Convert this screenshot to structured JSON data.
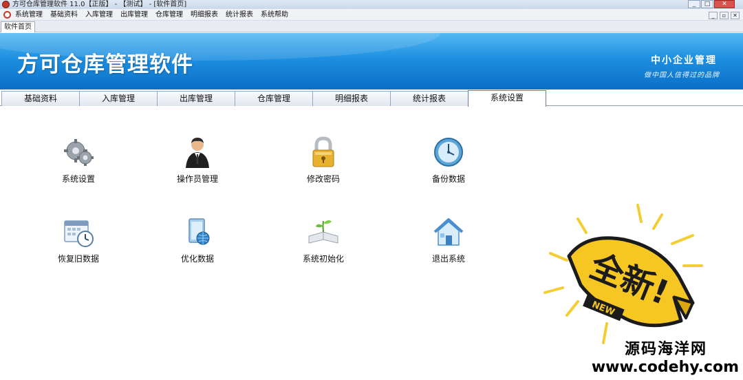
{
  "window": {
    "title": "方可仓库管理软件 11.0【正版】 - 【测试】 - [软件首页]",
    "controls": [
      "_",
      "□",
      "✕"
    ]
  },
  "menubar": {
    "items": [
      "系统管理",
      "基础资料",
      "入库管理",
      "出库管理",
      "仓库管理",
      "明细报表",
      "统计报表",
      "系统帮助"
    ],
    "mdi_controls": [
      "_",
      "▫",
      "✕"
    ]
  },
  "doc_tabs": {
    "active": "软件首页"
  },
  "banner": {
    "title": "方可仓库管理软件",
    "slogan": "中小企业管理",
    "sub_slogan": "做中国人信得过的品牌",
    "colors": {
      "top": "#55b8f2",
      "bottom": "#0a6fc7"
    }
  },
  "tabs": {
    "items": [
      "基础资料",
      "入库管理",
      "出库管理",
      "仓库管理",
      "明细报表",
      "统计报表",
      "系统设置"
    ],
    "active_index": 6
  },
  "functions": [
    {
      "label": "系统设置",
      "icon": "gears-icon"
    },
    {
      "label": "操作员管理",
      "icon": "operator-icon"
    },
    {
      "label": "修改密码",
      "icon": "padlock-icon"
    },
    {
      "label": "备份数据",
      "icon": "clock-icon"
    },
    {
      "label": "恢复旧数据",
      "icon": "calendar-clock-icon"
    },
    {
      "label": "优化数据",
      "icon": "document-globe-icon"
    },
    {
      "label": "系统初始化",
      "icon": "open-book-sprout-icon"
    },
    {
      "label": "退出系统",
      "icon": "house-icon"
    }
  ],
  "promo": {
    "big_text": "全新!",
    "small_text": "NEW"
  },
  "watermark": {
    "name": "源码海洋网",
    "url": "www.codehy.com"
  }
}
